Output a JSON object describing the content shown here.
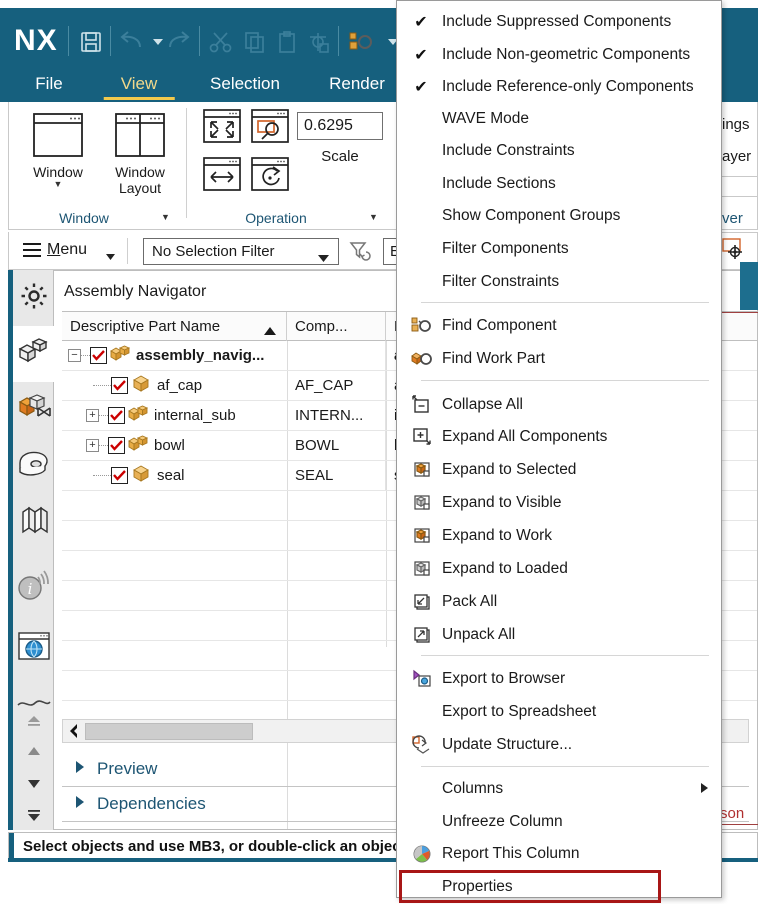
{
  "app": {
    "name": "NX",
    "quick_access": [
      "save-icon",
      "undo-icon",
      "undo-dropdown",
      "redo-icon",
      "cut-icon",
      "copy-icon",
      "paste-icon",
      "paste-special-icon",
      "find-component-icon",
      "find-dropdown"
    ]
  },
  "ribbon": {
    "tabs": [
      {
        "label": "File",
        "active": false
      },
      {
        "label": "View",
        "active": true
      },
      {
        "label": "Selection",
        "active": false
      },
      {
        "label": "Render",
        "active": false
      }
    ],
    "groups": [
      {
        "title": "Window",
        "buttons": [
          {
            "label": "Window",
            "icon": "window-icon",
            "dropdown": true
          },
          {
            "label": "Window Layout",
            "icon": "window-layout-icon",
            "dropdown": true
          }
        ]
      },
      {
        "title": "Operation",
        "buttons": [
          {
            "label": "",
            "icon": "fit-icon"
          },
          {
            "label": "",
            "icon": "zoom-icon"
          },
          {
            "label": "",
            "icon": "pan-icon"
          },
          {
            "label": "",
            "icon": "rotate-icon"
          }
        ],
        "scale_value": "0.6295",
        "scale_label": "Scale"
      }
    ]
  },
  "menu_bar": {
    "menu_label": "Menu",
    "selection_filter": "No Selection Filter",
    "filter_icon": "filter-reset-icon",
    "entity_value": "Entire Assembly"
  },
  "rail": {
    "items": [
      {
        "name": "sidebar-item-customize",
        "icon": "gear-icon",
        "active": false
      },
      {
        "name": "sidebar-item-assembly-navigator",
        "icon": "assembly-blocks-icon",
        "active": true
      },
      {
        "name": "sidebar-item-constraint-navigator",
        "icon": "constraint-icon",
        "active": false
      },
      {
        "name": "sidebar-item-part-navigator",
        "icon": "part-navigator-icon",
        "active": false
      },
      {
        "name": "sidebar-item-reuse-library",
        "icon": "books-icon",
        "active": false
      },
      {
        "name": "sidebar-item-hd3d",
        "icon": "info-broadcast-icon",
        "active": false
      },
      {
        "name": "sidebar-item-web-browser",
        "icon": "globe-window-icon",
        "active": false
      }
    ],
    "scroll_controls": [
      "scroll-top-icon",
      "scroll-up-icon",
      "scroll-down-icon",
      "scroll-bottom-icon"
    ]
  },
  "navigator": {
    "title": "Assembly Navigator",
    "columns": [
      {
        "label": "Descriptive Part Name",
        "sort": "asc"
      },
      {
        "label": "Comp..."
      },
      {
        "label": "Par"
      }
    ],
    "rows": [
      {
        "expander": "-",
        "indent": 0,
        "checked": true,
        "icon": "assembly-icon",
        "name": "assembly_navig...",
        "bold": true,
        "component": "",
        "part": "ass"
      },
      {
        "expander": "",
        "indent": 1,
        "checked": true,
        "icon": "part-icon",
        "name": "af_cap",
        "bold": false,
        "component": "AF_CAP",
        "part": "af_"
      },
      {
        "expander": "+",
        "indent": 1,
        "checked": true,
        "icon": "assembly-icon",
        "name": "internal_sub",
        "bold": false,
        "component": "INTERN...",
        "part": "inte"
      },
      {
        "expander": "+",
        "indent": 1,
        "checked": true,
        "icon": "assembly-icon",
        "name": "bowl",
        "bold": false,
        "component": "BOWL",
        "part": "bov"
      },
      {
        "expander": "",
        "indent": 1,
        "checked": true,
        "icon": "part-icon",
        "name": "seal",
        "bold": false,
        "component": "SEAL",
        "part": "sea"
      }
    ],
    "accordions": [
      {
        "label": "Preview",
        "expanded": false
      },
      {
        "label": "Dependencies",
        "expanded": false
      }
    ],
    "scrollbar": {
      "left_arrow": "chevron-left-icon"
    }
  },
  "status_bar": {
    "text": "Select objects and use MB3, or double-click an objec"
  },
  "background_widgets": {
    "texts": [
      "ings",
      "ayer",
      "ver",
      "son"
    ],
    "icons": [
      "datum-csys-icon"
    ]
  },
  "context_menu": {
    "items": [
      {
        "label": "Include Suppressed Components",
        "checked": true,
        "icon": "",
        "separator_after": false
      },
      {
        "label": "Include Non-geometric Components",
        "checked": true,
        "icon": "",
        "separator_after": false
      },
      {
        "label": "Include Reference-only Components",
        "checked": true,
        "icon": "",
        "separator_after": false
      },
      {
        "label": "WAVE Mode",
        "checked": false,
        "icon": "",
        "separator_after": false
      },
      {
        "label": "Include Constraints",
        "checked": false,
        "icon": "",
        "separator_after": false
      },
      {
        "label": "Include Sections",
        "checked": false,
        "icon": "",
        "separator_after": false
      },
      {
        "label": "Show Component Groups",
        "checked": false,
        "icon": "",
        "separator_after": false
      },
      {
        "label": "Filter Components",
        "checked": false,
        "icon": "",
        "separator_after": false
      },
      {
        "label": "Filter Constraints",
        "checked": false,
        "icon": "",
        "separator_after": true
      },
      {
        "label": "Find Component",
        "checked": false,
        "icon": "find-component-icon",
        "separator_after": false
      },
      {
        "label": "Find Work Part",
        "checked": false,
        "icon": "find-work-part-icon",
        "separator_after": true
      },
      {
        "label": "Collapse All",
        "checked": false,
        "icon": "collapse-all-icon",
        "separator_after": false
      },
      {
        "label": "Expand All Components",
        "checked": false,
        "icon": "expand-all-icon",
        "separator_after": false
      },
      {
        "label": "Expand to Selected",
        "checked": false,
        "icon": "expand-selected-icon",
        "separator_after": false
      },
      {
        "label": "Expand to Visible",
        "checked": false,
        "icon": "expand-visible-icon",
        "separator_after": false
      },
      {
        "label": "Expand to Work",
        "checked": false,
        "icon": "expand-work-icon",
        "separator_after": false
      },
      {
        "label": "Expand to Loaded",
        "checked": false,
        "icon": "expand-loaded-icon",
        "separator_after": false
      },
      {
        "label": "Pack All",
        "checked": false,
        "icon": "pack-all-icon",
        "separator_after": false
      },
      {
        "label": "Unpack All",
        "checked": false,
        "icon": "unpack-all-icon",
        "separator_after": true
      },
      {
        "label": "Export to Browser",
        "checked": false,
        "icon": "export-browser-icon",
        "separator_after": false
      },
      {
        "label": "Export to Spreadsheet",
        "checked": false,
        "icon": "",
        "separator_after": false
      },
      {
        "label": "Update Structure...",
        "checked": false,
        "icon": "update-structure-icon",
        "separator_after": true
      },
      {
        "label": "Columns",
        "checked": false,
        "icon": "",
        "submenu": true,
        "separator_after": false
      },
      {
        "label": "Unfreeze Column",
        "checked": false,
        "icon": "",
        "separator_after": false
      },
      {
        "label": "Report This Column",
        "checked": false,
        "icon": "report-column-icon",
        "separator_after": false
      },
      {
        "label": "Properties",
        "checked": false,
        "icon": "",
        "highlighted": true,
        "separator_after": false
      }
    ]
  },
  "colors": {
    "header_blue": "#16607e",
    "tab_active": "#f2d98b",
    "tab_underline": "#f2c94c",
    "accent_orange": "#e07b21",
    "highlight_red": "#a81616",
    "link_blue": "#1d5573"
  }
}
